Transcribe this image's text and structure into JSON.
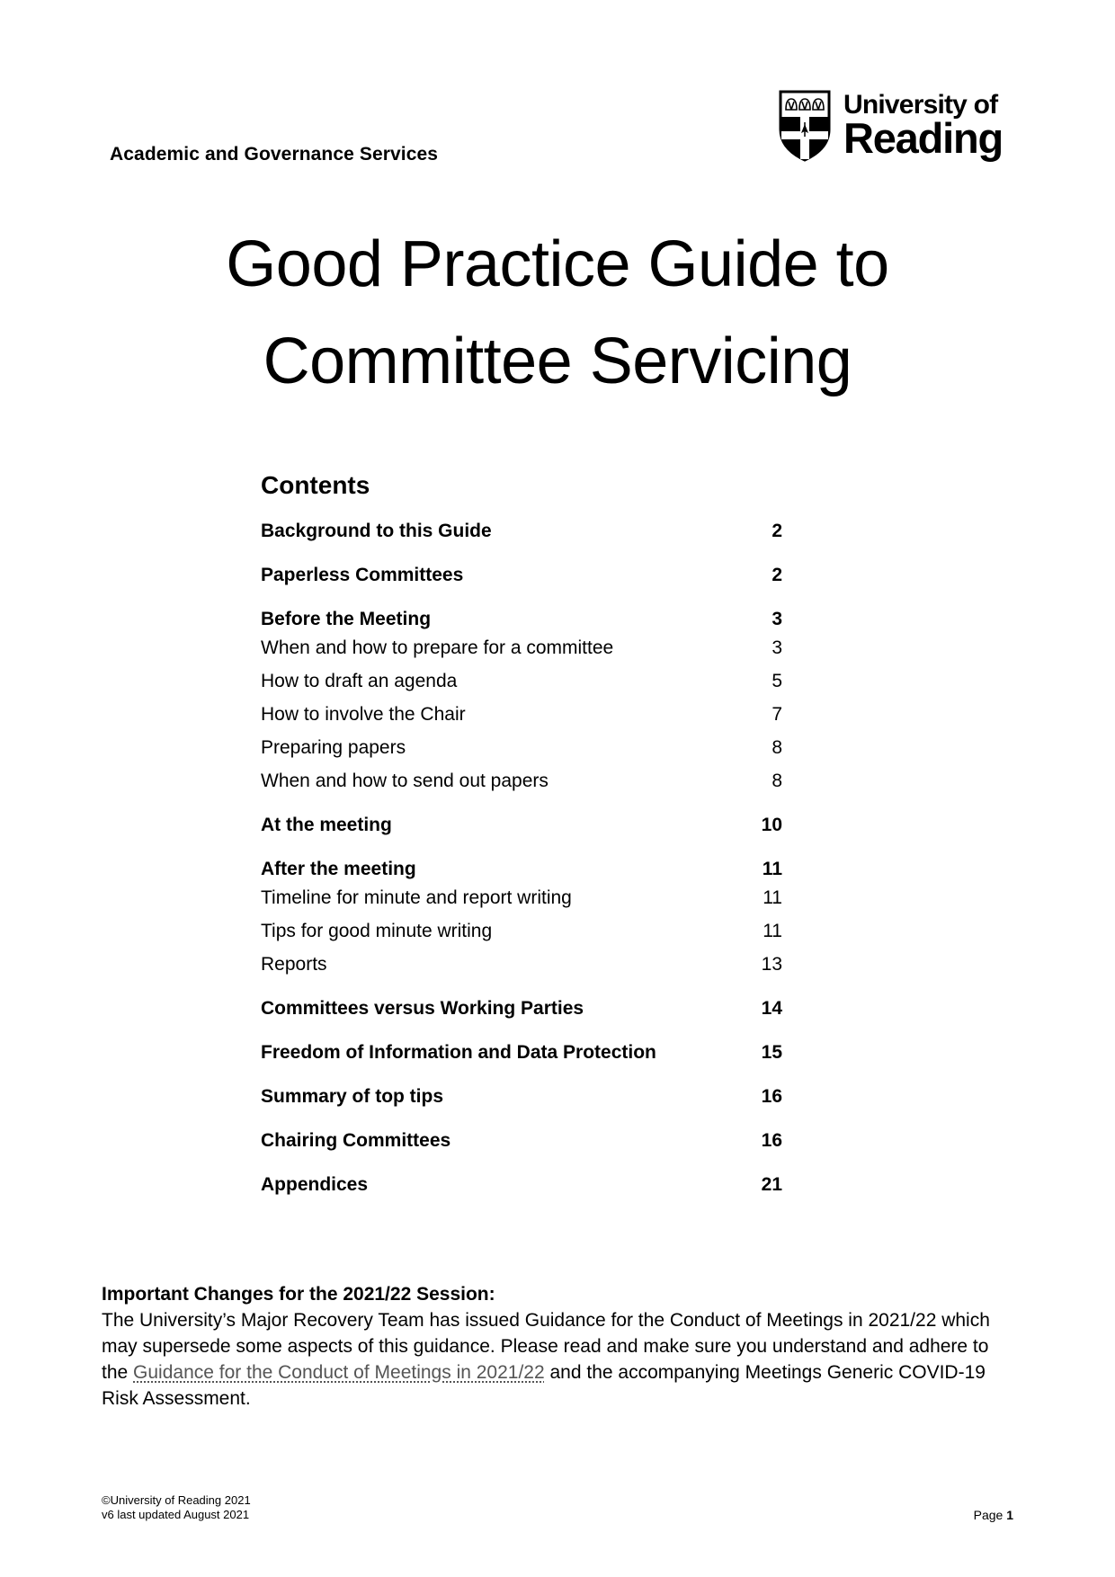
{
  "header": {
    "department": "Academic and Governance Services",
    "logo": {
      "line1": "University of",
      "line2": "Reading",
      "crest_icon": "university-crest-icon"
    }
  },
  "title": {
    "line1": "Good Practice Guide to",
    "line2": "Committee Servicing"
  },
  "contents": {
    "heading": "Contents",
    "entries": [
      {
        "label": "Background to this Guide",
        "page": "2",
        "level": "main"
      },
      {
        "label": "Paperless Committees",
        "page": "2",
        "level": "main"
      },
      {
        "label": "Before the Meeting",
        "page": "3",
        "level": "main"
      },
      {
        "label": "When and how to prepare for a committee",
        "page": "3",
        "level": "sub"
      },
      {
        "label": "How to draft an agenda",
        "page": "5",
        "level": "sub"
      },
      {
        "label": "How to involve the Chair",
        "page": "7",
        "level": "sub"
      },
      {
        "label": "Preparing papers",
        "page": "8",
        "level": "sub"
      },
      {
        "label": "When and how to send out papers",
        "page": "8",
        "level": "sub"
      },
      {
        "label": "At the meeting",
        "page": "10",
        "level": "main"
      },
      {
        "label": "After the meeting",
        "page": "11",
        "level": "main"
      },
      {
        "label": "Timeline for minute and report writing",
        "page": "11",
        "level": "sub"
      },
      {
        "label": "Tips for good minute writing",
        "page": "11",
        "level": "sub"
      },
      {
        "label": "Reports",
        "page": "13",
        "level": "sub"
      },
      {
        "label": "Committees versus Working Parties",
        "page": "14",
        "level": "main"
      },
      {
        "label": "Freedom of Information and Data Protection",
        "page": "15",
        "level": "main"
      },
      {
        "label": "Summary of top tips",
        "page": "16",
        "level": "main"
      },
      {
        "label": "Chairing Committees",
        "page": "16",
        "level": "main"
      },
      {
        "label": "Appendices",
        "page": "21",
        "level": "main"
      }
    ]
  },
  "notice": {
    "heading": "Important Changes for the 2021/22 Session:",
    "text_before_link": "The University’s Major Recovery Team has issued Guidance for the Conduct of Meetings in 2021/22 which may supersede some aspects of this guidance. Please read and make sure you understand and adhere to the ",
    "link_text": "Guidance for the Conduct of Meetings in 2021/22",
    "text_after_link": " and the accompanying Meetings Generic COVID-19 Risk Assessment.",
    "link_color": "#555555"
  },
  "footer": {
    "copyright": "©University of Reading 2021",
    "version": "v6 last updated August 2021",
    "page_label": "Page",
    "page_number": "1"
  }
}
